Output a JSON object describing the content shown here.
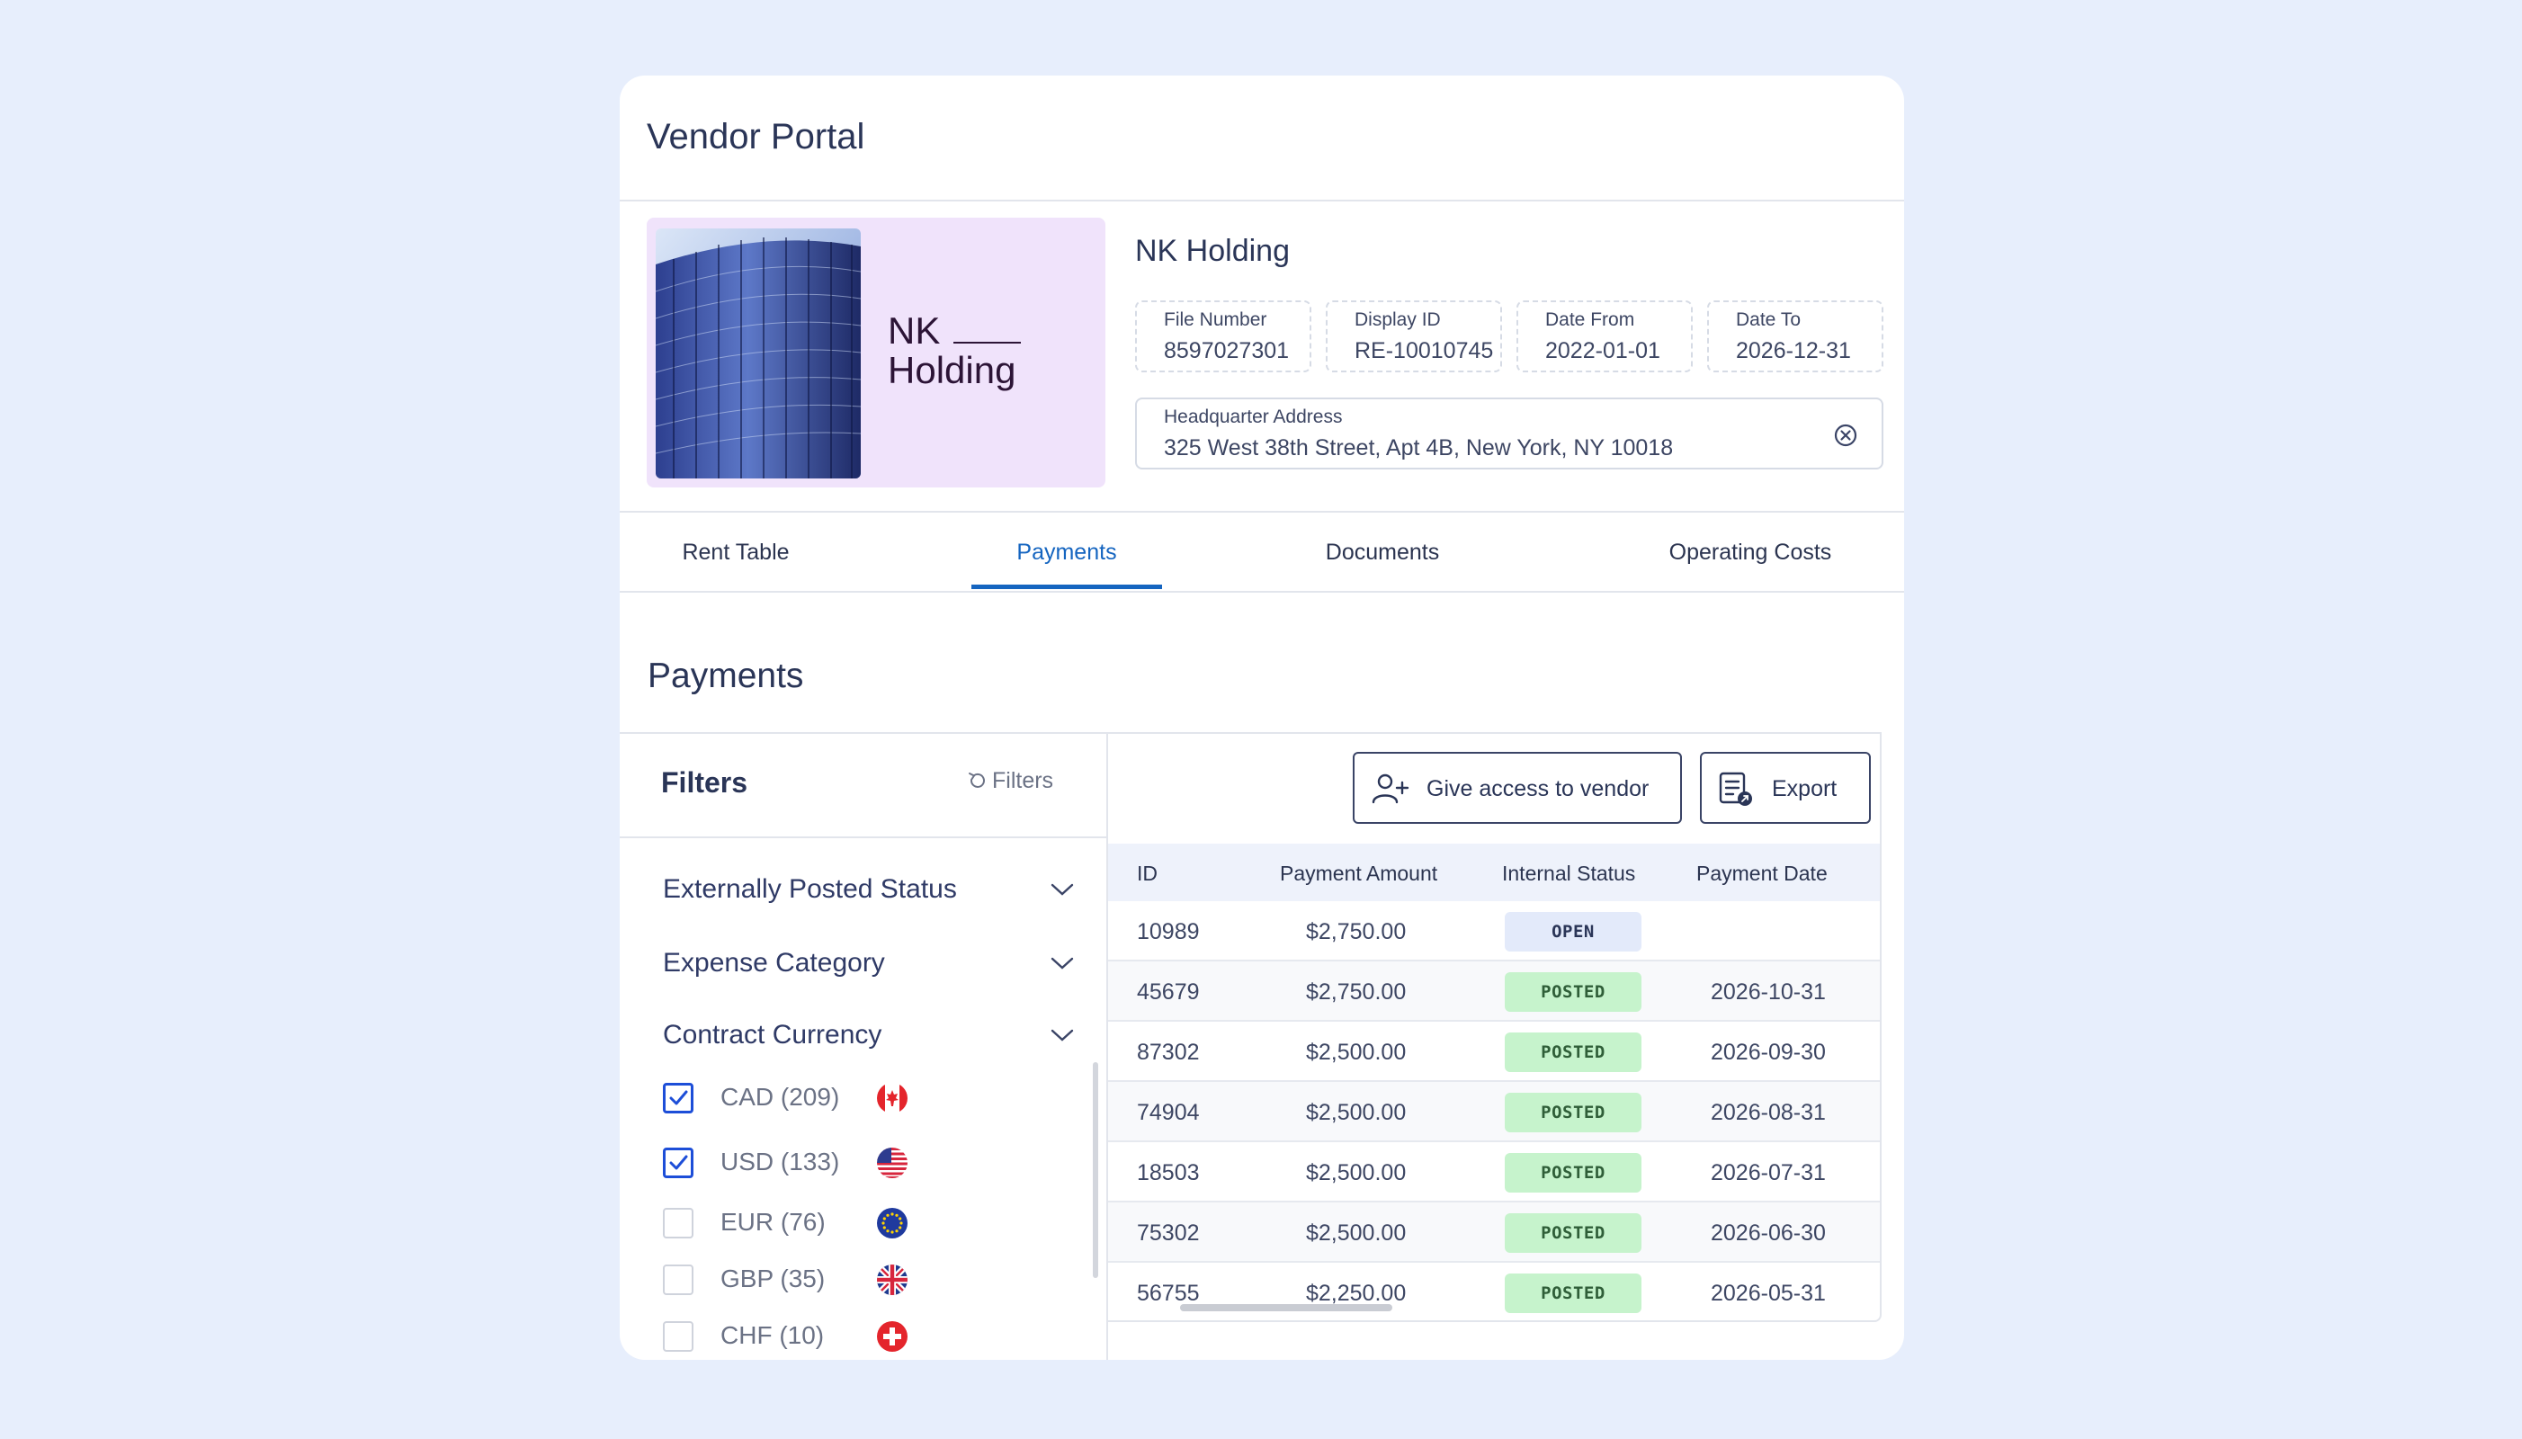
{
  "app": {
    "title": "Vendor Portal"
  },
  "vendor": {
    "logo_line1": "NK",
    "logo_line2": "Holding",
    "name": "NK Holding",
    "fields": {
      "file_number": {
        "label": "File Number",
        "value": "8597027301"
      },
      "display_id": {
        "label": "Display ID",
        "value": "RE-10010745"
      },
      "date_from": {
        "label": "Date From",
        "value": "2022-01-01"
      },
      "date_to": {
        "label": "Date To",
        "value": "2026-12-31"
      },
      "address": {
        "label": "Headquarter Address",
        "value": "325 West 38th Street, Apt 4B, New York, NY 10018"
      }
    }
  },
  "tabs": [
    {
      "label": "Rent Table",
      "active": false
    },
    {
      "label": "Payments",
      "active": true
    },
    {
      "label": "Documents",
      "active": false
    },
    {
      "label": "Operating Costs",
      "active": false
    }
  ],
  "section": {
    "title": "Payments"
  },
  "filters": {
    "title": "Filters",
    "reset_label": "Filters",
    "groups": [
      "Externally Posted Status",
      "Expense Category",
      "Contract Currency"
    ],
    "currencies": [
      {
        "label": "CAD (209)",
        "checked": true,
        "flag": "canada-flag-icon"
      },
      {
        "label": "USD (133)",
        "checked": true,
        "flag": "usa-flag-icon"
      },
      {
        "label": "EUR (76)",
        "checked": false,
        "flag": "eu-flag-icon"
      },
      {
        "label": "GBP (35)",
        "checked": false,
        "flag": "uk-flag-icon"
      },
      {
        "label": "CHF (10)",
        "checked": false,
        "flag": "swiss-flag-icon"
      }
    ]
  },
  "toolbar": {
    "give_access_label": "Give access to vendor",
    "export_label": "Export"
  },
  "table": {
    "columns": [
      "ID",
      "Payment Amount",
      "Internal Status",
      "Payment Date"
    ],
    "rows": [
      {
        "id": "10989",
        "amount": "$2,750.00",
        "status": "OPEN",
        "date": ""
      },
      {
        "id": "45679",
        "amount": "$2,750.00",
        "status": "POSTED",
        "date": "2026-10-31"
      },
      {
        "id": "87302",
        "amount": "$2,500.00",
        "status": "POSTED",
        "date": "2026-09-30"
      },
      {
        "id": "74904",
        "amount": "$2,500.00",
        "status": "POSTED",
        "date": "2026-08-31"
      },
      {
        "id": "18503",
        "amount": "$2,500.00",
        "status": "POSTED",
        "date": "2026-07-31"
      },
      {
        "id": "75302",
        "amount": "$2,500.00",
        "status": "POSTED",
        "date": "2026-06-30"
      },
      {
        "id": "56755",
        "amount": "$2,250.00",
        "status": "POSTED",
        "date": "2026-05-31"
      }
    ]
  },
  "colors": {
    "background": "#e7eefc",
    "accent": "#1565c0",
    "checkbox": "#1d4ed8",
    "posted_badge": "#c6f3cc",
    "open_badge": "#e3eafa",
    "logo_bg": "#f0e3fb"
  }
}
